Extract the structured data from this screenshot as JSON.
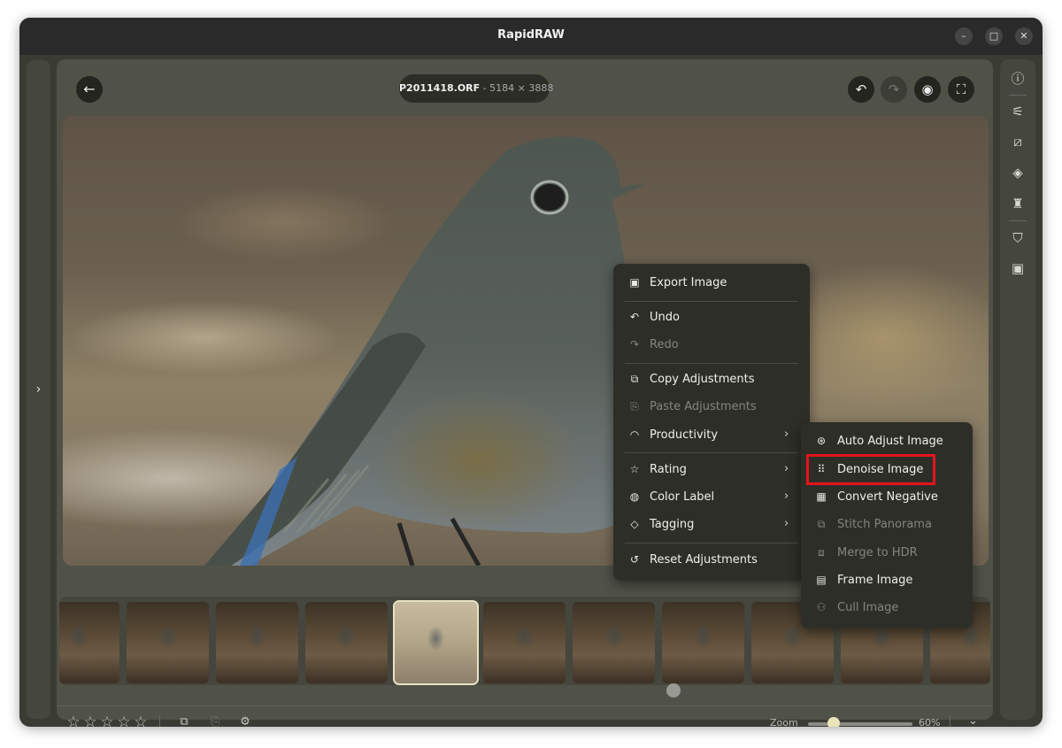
{
  "window": {
    "title": "RapidRAW",
    "minimize_icon": "–",
    "maximize_icon": "□",
    "close_icon": "✕"
  },
  "header": {
    "filename": "P2011418.ORF",
    "dimensions": "- 5184 × 3888"
  },
  "viewer": {
    "image_subject": "bird photo"
  },
  "context_menu": {
    "items": [
      {
        "label": "Export Image",
        "icon": "save-icon",
        "enabled": true
      },
      {
        "label": "Undo",
        "icon": "undo-icon",
        "enabled": true
      },
      {
        "label": "Redo",
        "icon": "redo-icon",
        "enabled": false
      },
      {
        "label": "Copy Adjustments",
        "icon": "copy-icon",
        "enabled": true
      },
      {
        "label": "Paste Adjustments",
        "icon": "paste-icon",
        "enabled": false
      },
      {
        "label": "Productivity",
        "icon": "gauge-icon",
        "enabled": true,
        "submenu": true
      },
      {
        "label": "Rating",
        "icon": "star-icon",
        "enabled": true,
        "submenu": true
      },
      {
        "label": "Color Label",
        "icon": "palette-icon",
        "enabled": true,
        "submenu": true
      },
      {
        "label": "Tagging",
        "icon": "tag-icon",
        "enabled": true,
        "submenu": true
      },
      {
        "label": "Reset Adjustments",
        "icon": "reset-icon",
        "enabled": true
      }
    ]
  },
  "productivity_submenu": {
    "items": [
      {
        "label": "Auto Adjust Image",
        "icon": "aperture-icon",
        "enabled": true
      },
      {
        "label": "Denoise Image",
        "icon": "grid-icon",
        "enabled": true,
        "highlighted": true
      },
      {
        "label": "Convert Negative",
        "icon": "film-icon",
        "enabled": true
      },
      {
        "label": "Stitch Panorama",
        "icon": "panorama-icon",
        "enabled": false
      },
      {
        "label": "Merge to HDR",
        "icon": "hdr-icon",
        "enabled": false
      },
      {
        "label": "Frame Image",
        "icon": "frame-icon",
        "enabled": true
      },
      {
        "label": "Cull Image",
        "icon": "users-icon",
        "enabled": false
      }
    ]
  },
  "filmstrip": {
    "thumbnail_count": 11,
    "active_index": 4
  },
  "bottom_bar": {
    "rating": 0,
    "zoom_label": "Zoom",
    "zoom_value": "60%",
    "zoom_fraction": 0.6
  },
  "right_panel": {
    "icons": [
      "info-icon",
      "sliders-icon",
      "crop-icon",
      "layers-icon",
      "brush-icon",
      "bookmark-icon",
      "save-icon"
    ]
  },
  "colors": {
    "highlight": "#e4141b",
    "accent": "#e9e3b8",
    "menu_bg": "#2d2e28"
  }
}
